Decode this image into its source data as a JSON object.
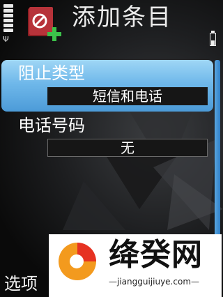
{
  "header": {
    "title": "添加条目",
    "app_icon": "blocked-entry-add-icon"
  },
  "status": {
    "signal_icon": "signal-strength-icon",
    "signal_level": 1.0,
    "battery_icon": "battery-icon",
    "battery_level": 0.3
  },
  "form": {
    "items": [
      {
        "label": "阻止类型",
        "value": "短信和电话",
        "selected": true
      },
      {
        "label": "电话号码",
        "value": "无",
        "selected": false
      }
    ]
  },
  "softkeys": {
    "left": "选项"
  },
  "watermark": {
    "brand": "绛癸网",
    "url": "jiangguijiuye.com"
  },
  "colors": {
    "highlight": "#6fb8ea",
    "background": "#1d1e20",
    "watermark_orange": "#f39a1e",
    "watermark_red": "#e63222"
  }
}
